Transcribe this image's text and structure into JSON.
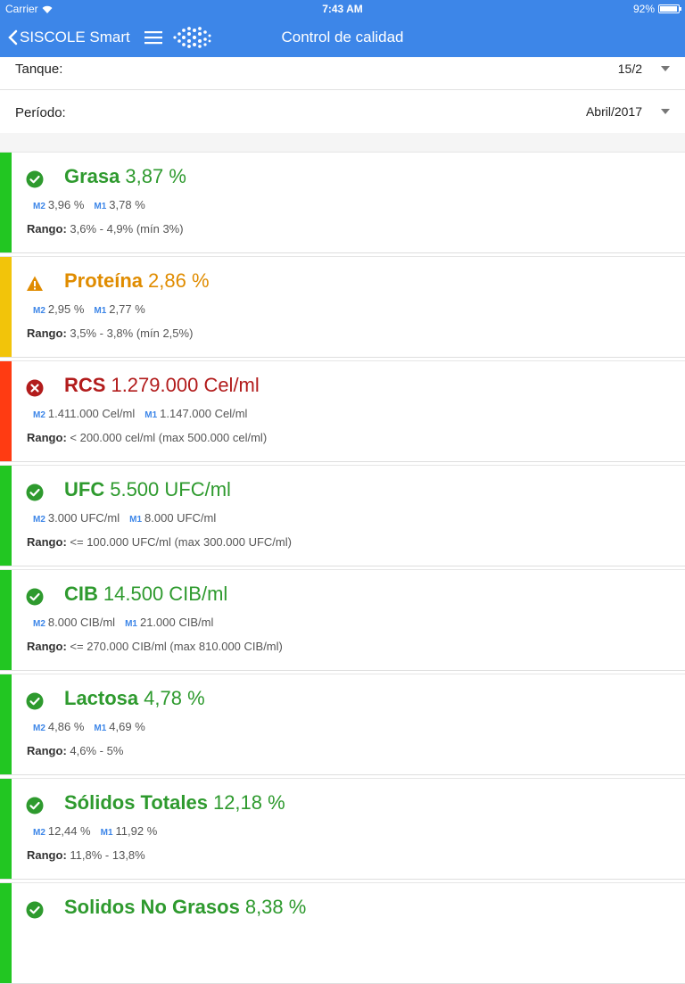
{
  "status_bar": {
    "carrier": "Carrier",
    "time": "7:43 AM",
    "battery": "92%"
  },
  "nav": {
    "back_label": "SISCOLE Smart",
    "title": "Control de calidad"
  },
  "filters": {
    "tank": {
      "label": "Tanque:",
      "value": "15/2"
    },
    "period": {
      "label": "Período:",
      "value": "Abril/2017"
    }
  },
  "range_label": "Rango:",
  "colors": {
    "ok": "#22c622",
    "warning": "#f2c40a",
    "error": "#ff3b12",
    "accent": "#3d86e8"
  },
  "metrics": [
    {
      "name": "Grasa",
      "value": "3,87 %",
      "status": "ok",
      "m2_tag": "M2",
      "m2": "3,96 %",
      "m1_tag": "M1",
      "m1": "3,78 %",
      "range": "3,6% - 4,9% (mín 3%)"
    },
    {
      "name": "Proteína",
      "value": "2,86 %",
      "status": "warning",
      "m2_tag": "M2",
      "m2": "2,95 %",
      "m1_tag": "M1",
      "m1": "2,77 %",
      "range": "3,5% - 3,8% (mín 2,5%)"
    },
    {
      "name": "RCS",
      "value": "1.279.000 Cel/ml",
      "status": "error",
      "m2_tag": "M2",
      "m2": "1.411.000 Cel/ml",
      "m1_tag": "M1",
      "m1": "1.147.000 Cel/ml",
      "range": "< 200.000 cel/ml (max 500.000 cel/ml)"
    },
    {
      "name": "UFC",
      "value": "5.500 UFC/ml",
      "status": "ok",
      "m2_tag": "M2",
      "m2": "3.000 UFC/ml",
      "m1_tag": "M1",
      "m1": "8.000 UFC/ml",
      "range": "<= 100.000 UFC/ml (max 300.000 UFC/ml)"
    },
    {
      "name": "CIB",
      "value": "14.500 CIB/ml",
      "status": "ok",
      "m2_tag": "M2",
      "m2": "8.000 CIB/ml",
      "m1_tag": "M1",
      "m1": "21.000 CIB/ml",
      "range": "<= 270.000 CIB/ml (max 810.000 CIB/ml)"
    },
    {
      "name": "Lactosa",
      "value": "4,78 %",
      "status": "ok",
      "m2_tag": "M2",
      "m2": "4,86 %",
      "m1_tag": "M1",
      "m1": "4,69 %",
      "range": "4,6% - 5%"
    },
    {
      "name": "Sólidos Totales",
      "value": "12,18 %",
      "status": "ok",
      "m2_tag": "M2",
      "m2": "12,44 %",
      "m1_tag": "M1",
      "m1": "11,92 %",
      "range": "11,8% - 13,8%"
    },
    {
      "name": "Solidos No Grasos",
      "value": "8,38 %",
      "status": "ok",
      "m2_tag": "",
      "m2": "",
      "m1_tag": "",
      "m1": "",
      "range": ""
    }
  ]
}
